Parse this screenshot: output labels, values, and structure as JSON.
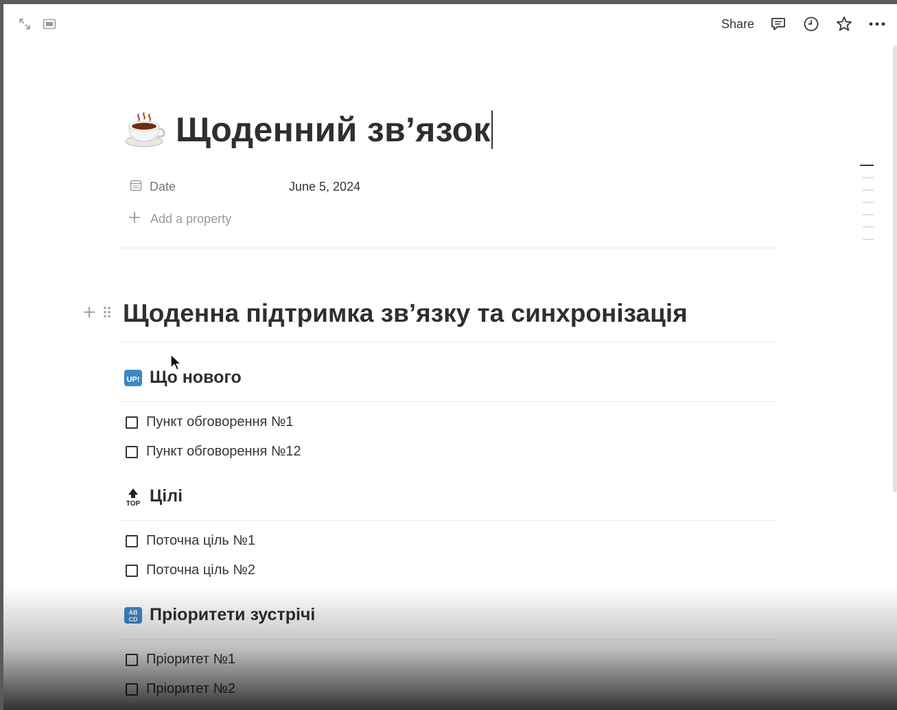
{
  "topbar": {
    "expand_icon": "expand-icon",
    "sidepeek_icon": "side-peek-icon",
    "share_label": "Share",
    "comment_icon": "comment-icon",
    "history_icon": "clock-icon",
    "favorite_icon": "star-icon",
    "more_icon": "more-icon"
  },
  "page": {
    "icon": "coffee-cup-icon",
    "title": "Щоденний зв’язок"
  },
  "properties": [
    {
      "icon": "calendar-icon",
      "name": "Date",
      "value": "June 5, 2024"
    }
  ],
  "add_property_label": "Add a property",
  "heading1": "Щоденна підтримка зв’язку та синхронізація",
  "sections": [
    {
      "icon": "up-icon",
      "icon_text": "UP!",
      "title": "Що нового",
      "items": [
        "Пункт обговорення №1",
        "Пункт обговорення №12"
      ]
    },
    {
      "icon": "top-arrow-icon",
      "icon_text": "TOP",
      "title": "Цілі",
      "items": [
        "Поточна ціль №1",
        "Поточна ціль №2"
      ]
    },
    {
      "icon": "abcd-icon",
      "icon_text": "AB CD",
      "title": "Пріоритети зустрічі",
      "items": [
        "Пріоритет №1",
        "Пріоритет №2"
      ]
    }
  ],
  "colors": {
    "text": "#37352f",
    "muted": "#787774",
    "accent_blue": "#3d86c6"
  }
}
